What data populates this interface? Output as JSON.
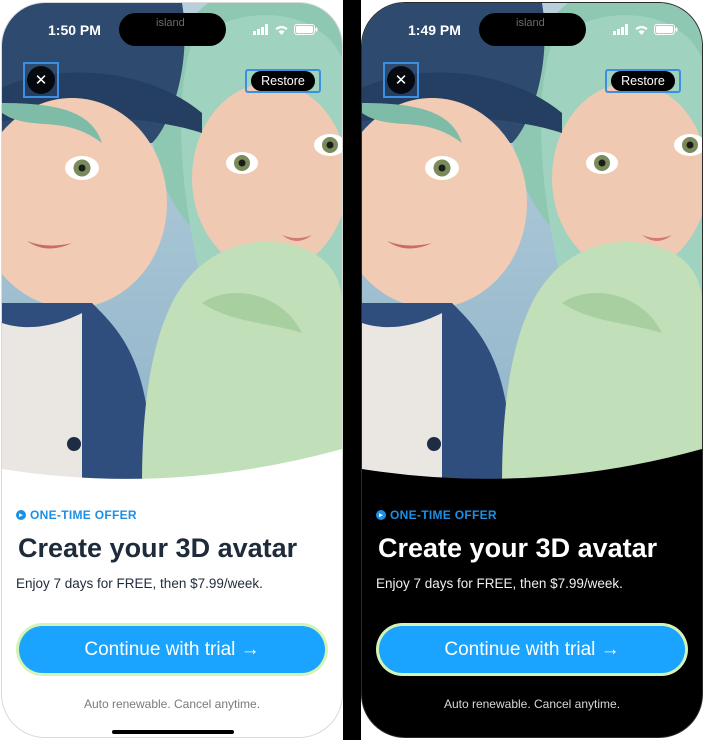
{
  "screens": [
    {
      "theme": "light",
      "status_time": "1:50 PM",
      "island_label": "island",
      "close_symbol": "✕",
      "restore_label": "Restore",
      "offer_label": "ONE-TIME OFFER",
      "title": "Create your 3D avatar",
      "subtitle": "Enjoy 7 days for FREE, then $7.99/week.",
      "cta_label": "Continue with trial →",
      "footnote": "Auto renewable. Cancel anytime."
    },
    {
      "theme": "dark",
      "status_time": "1:49 PM",
      "island_label": "island",
      "close_symbol": "✕",
      "restore_label": "Restore",
      "offer_label": "ONE-TIME OFFER",
      "title": "Create your 3D avatar",
      "subtitle": "Enjoy 7 days for FREE, then $7.99/week.",
      "cta_label": "Continue with trial →",
      "footnote": "Auto renewable. Cancel anytime."
    }
  ],
  "colors": {
    "accent": "#1aa3ff",
    "offer_text": "#1d8fe5",
    "cta_border": "#d6f3b6",
    "annotation_box": "#3d8fe0",
    "light_bg": "#ffffff",
    "dark_bg": "#000000"
  },
  "icons": [
    "close-icon",
    "signal-icon",
    "wifi-icon",
    "battery-icon",
    "offer-badge-icon",
    "arrow-right-icon"
  ]
}
